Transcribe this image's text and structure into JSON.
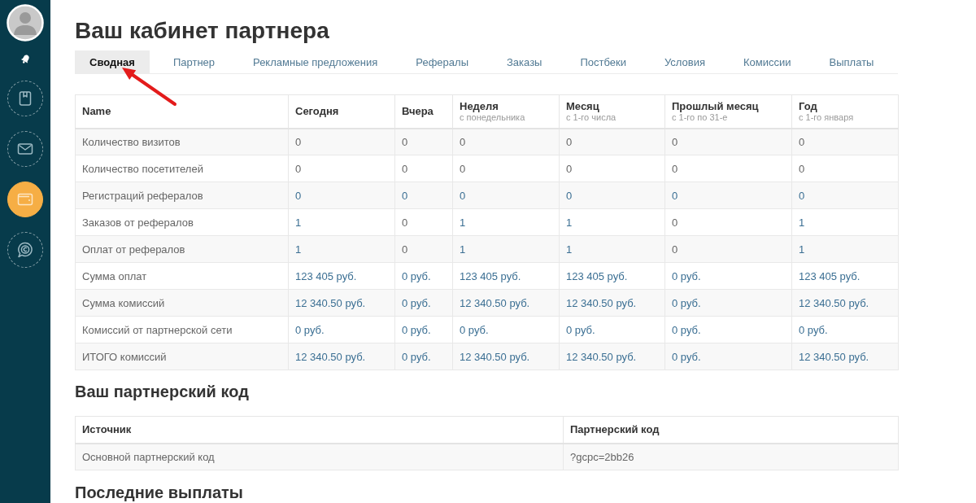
{
  "sidebar": {
    "nav_items": [
      {
        "selected": false
      },
      {
        "selected": false
      },
      {
        "selected": true
      },
      {
        "selected": false
      }
    ]
  },
  "title": "Ваш кабинет партнера",
  "tabs": [
    {
      "label": "Сводная",
      "selected": true
    },
    {
      "label": "Партнер",
      "selected": false
    },
    {
      "label": "Рекламные предложения",
      "selected": false
    },
    {
      "label": "Рефералы",
      "selected": false
    },
    {
      "label": "Заказы",
      "selected": false
    },
    {
      "label": "Постбеки",
      "selected": false
    },
    {
      "label": "Условия",
      "selected": false
    },
    {
      "label": "Комиссии",
      "selected": false
    },
    {
      "label": "Выплаты",
      "selected": false
    }
  ],
  "summary_table": {
    "columns": [
      {
        "label": "Name"
      },
      {
        "label": "Сегодня"
      },
      {
        "label": "Вчера"
      },
      {
        "label": "Неделя",
        "note": "с понедельника"
      },
      {
        "label": "Месяц",
        "note": "с 1-го числа"
      },
      {
        "label": "Прошлый месяц",
        "note": "с 1-го по 31-е"
      },
      {
        "label": "Год",
        "note": "с 1-го января"
      }
    ],
    "rows": [
      {
        "cells": [
          {
            "text": "Количество визитов",
            "link": false
          },
          {
            "text": "0",
            "link": false
          },
          {
            "text": "0",
            "link": false
          },
          {
            "text": "0",
            "link": false
          },
          {
            "text": "0",
            "link": false
          },
          {
            "text": "0",
            "link": false
          },
          {
            "text": "0",
            "link": false
          }
        ]
      },
      {
        "cells": [
          {
            "text": "Количество посетителей",
            "link": false
          },
          {
            "text": "0",
            "link": false
          },
          {
            "text": "0",
            "link": false
          },
          {
            "text": "0",
            "link": false
          },
          {
            "text": "0",
            "link": false
          },
          {
            "text": "0",
            "link": false
          },
          {
            "text": "0",
            "link": false
          }
        ]
      },
      {
        "cells": [
          {
            "text": "Регистраций рефералов",
            "link": false
          },
          {
            "text": "0",
            "link": true
          },
          {
            "text": "0",
            "link": true
          },
          {
            "text": "0",
            "link": true
          },
          {
            "text": "0",
            "link": true
          },
          {
            "text": "0",
            "link": true
          },
          {
            "text": "0",
            "link": true
          }
        ]
      },
      {
        "cells": [
          {
            "text": "Заказов от рефералов",
            "link": false
          },
          {
            "text": "1",
            "link": true
          },
          {
            "text": "0",
            "link": false
          },
          {
            "text": "1",
            "link": true
          },
          {
            "text": "1",
            "link": true
          },
          {
            "text": "0",
            "link": false
          },
          {
            "text": "1",
            "link": true
          }
        ]
      },
      {
        "cells": [
          {
            "text": "Оплат от рефералов",
            "link": false
          },
          {
            "text": "1",
            "link": true
          },
          {
            "text": "0",
            "link": false
          },
          {
            "text": "1",
            "link": true
          },
          {
            "text": "1",
            "link": true
          },
          {
            "text": "0",
            "link": false
          },
          {
            "text": "1",
            "link": true
          }
        ]
      },
      {
        "cells": [
          {
            "text": "Сумма оплат",
            "link": false
          },
          {
            "text": "123 405 руб.",
            "link": true
          },
          {
            "text": "0 руб.",
            "link": true
          },
          {
            "text": "123 405 руб.",
            "link": true
          },
          {
            "text": "123 405 руб.",
            "link": true
          },
          {
            "text": "0 руб.",
            "link": true
          },
          {
            "text": "123 405 руб.",
            "link": true
          }
        ]
      },
      {
        "cells": [
          {
            "text": "Сумма комиссий",
            "link": false
          },
          {
            "text": "12 340.50 руб.",
            "link": true
          },
          {
            "text": "0 руб.",
            "link": true
          },
          {
            "text": "12 340.50 руб.",
            "link": true
          },
          {
            "text": "12 340.50 руб.",
            "link": true
          },
          {
            "text": "0 руб.",
            "link": true
          },
          {
            "text": "12 340.50 руб.",
            "link": true
          }
        ]
      },
      {
        "cells": [
          {
            "text": "Комиссий от партнерской сети",
            "link": false
          },
          {
            "text": "0 руб.",
            "link": true
          },
          {
            "text": "0 руб.",
            "link": true
          },
          {
            "text": "0 руб.",
            "link": true
          },
          {
            "text": "0 руб.",
            "link": true
          },
          {
            "text": "0 руб.",
            "link": true
          },
          {
            "text": "0 руб.",
            "link": true
          }
        ]
      },
      {
        "cells": [
          {
            "text": "ИТОГО комиссий",
            "link": false
          },
          {
            "text": "12 340.50 руб.",
            "link": true
          },
          {
            "text": "0 руб.",
            "link": true
          },
          {
            "text": "12 340.50 руб.",
            "link": true
          },
          {
            "text": "12 340.50 руб.",
            "link": true
          },
          {
            "text": "0 руб.",
            "link": true
          },
          {
            "text": "12 340.50 руб.",
            "link": true
          }
        ]
      }
    ]
  },
  "partner_code": {
    "heading": "Ваш партнерский код",
    "columns": [
      "Источник",
      "Партнерский код"
    ],
    "rows": [
      [
        "Основной партнерский код",
        "?gcpc=2bb26"
      ]
    ]
  },
  "payouts": {
    "heading": "Последние выплаты"
  }
}
